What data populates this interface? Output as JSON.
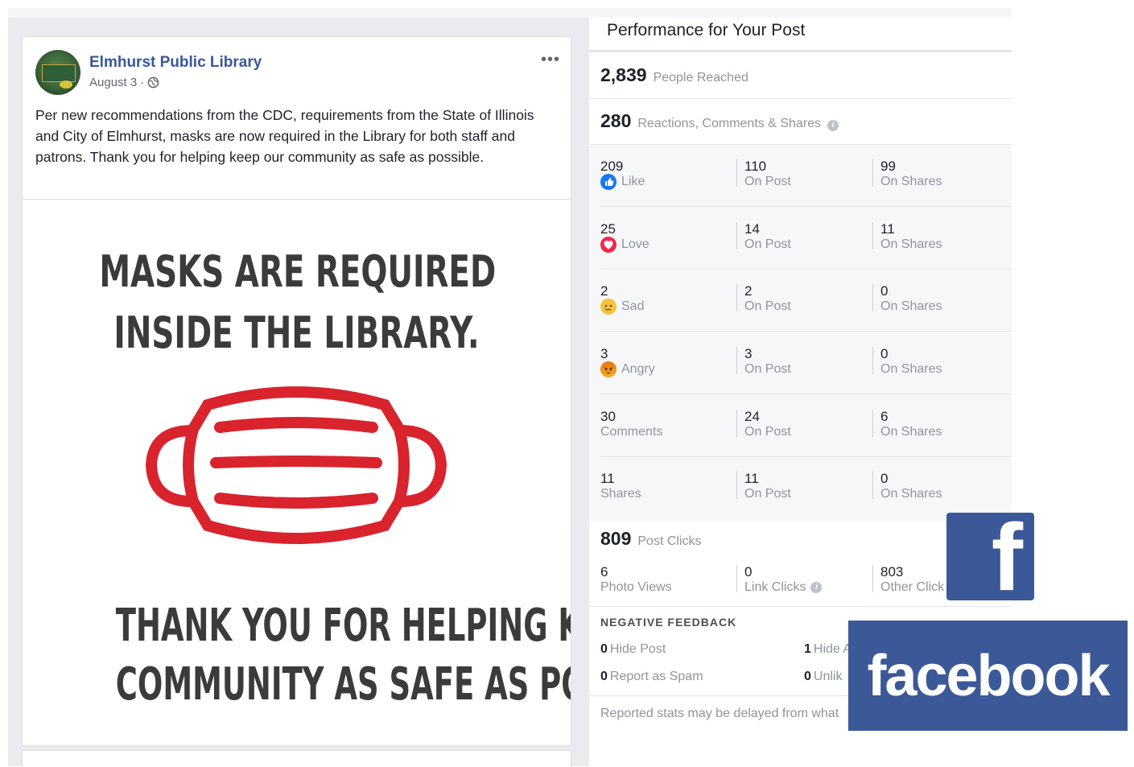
{
  "post": {
    "page_name": "Elmhurst Public Library",
    "date": "August 3 ·",
    "text": "Per new recommendations from the CDC, requirements from the State of Illinois and City of Elmhurst, masks are now required in the Library for both staff and patrons. Thank you for helping keep our community as safe as possible.",
    "more_icon": "•••",
    "image": {
      "line1": "MASKS ARE REQUIRED",
      "line2": "INSIDE THE LIBRARY.",
      "line3": "THANK YOU FOR HELPING KEEP OUR",
      "line4": "COMMUNITY AS SAFE AS POSSIBLE.",
      "mask_color": "#d9232d"
    }
  },
  "insights": {
    "title": "Performance for Your Post",
    "reached": {
      "value": "2,839",
      "label": "People Reached"
    },
    "engagement": {
      "value": "280",
      "label": "Reactions, Comments & Shares"
    },
    "rows": [
      {
        "total": "209",
        "label": "Like",
        "icon": "like-icon",
        "on_post": "110",
        "on_post_label": "On Post",
        "on_shares": "99",
        "on_shares_label": "On Shares"
      },
      {
        "total": "25",
        "label": "Love",
        "icon": "love-icon",
        "on_post": "14",
        "on_post_label": "On Post",
        "on_shares": "11",
        "on_shares_label": "On Shares"
      },
      {
        "total": "2",
        "label": "Sad",
        "icon": "sad-icon",
        "on_post": "2",
        "on_post_label": "On Post",
        "on_shares": "0",
        "on_shares_label": "On Shares"
      },
      {
        "total": "3",
        "label": "Angry",
        "icon": "angry-icon",
        "on_post": "3",
        "on_post_label": "On Post",
        "on_shares": "0",
        "on_shares_label": "On Shares"
      },
      {
        "total": "30",
        "label": "Comments",
        "icon": "",
        "on_post": "24",
        "on_post_label": "On Post",
        "on_shares": "6",
        "on_shares_label": "On Shares"
      },
      {
        "total": "11",
        "label": "Shares",
        "icon": "",
        "on_post": "11",
        "on_post_label": "On Post",
        "on_shares": "0",
        "on_shares_label": "On Shares"
      }
    ],
    "clicks": {
      "value": "809",
      "label": "Post Clicks",
      "photo_views": "6",
      "photo_views_label": "Photo Views",
      "link_clicks": "0",
      "link_clicks_label": "Link Clicks",
      "other_clicks": "803",
      "other_clicks_label": "Other Click"
    },
    "negative": {
      "title": "NEGATIVE FEEDBACK",
      "hide_post": "0",
      "hide_post_label": "Hide Post",
      "hide_all": "1",
      "hide_all_label": "Hide A",
      "spam": "0",
      "spam_label": "Report as Spam",
      "unlike": "0",
      "unlike_label": "Unlik"
    },
    "footnote": "Reported stats may be delayed from what"
  },
  "logos": {
    "square_letter": "f",
    "wordmark": "facebook",
    "brand_color": "#3b5998"
  }
}
